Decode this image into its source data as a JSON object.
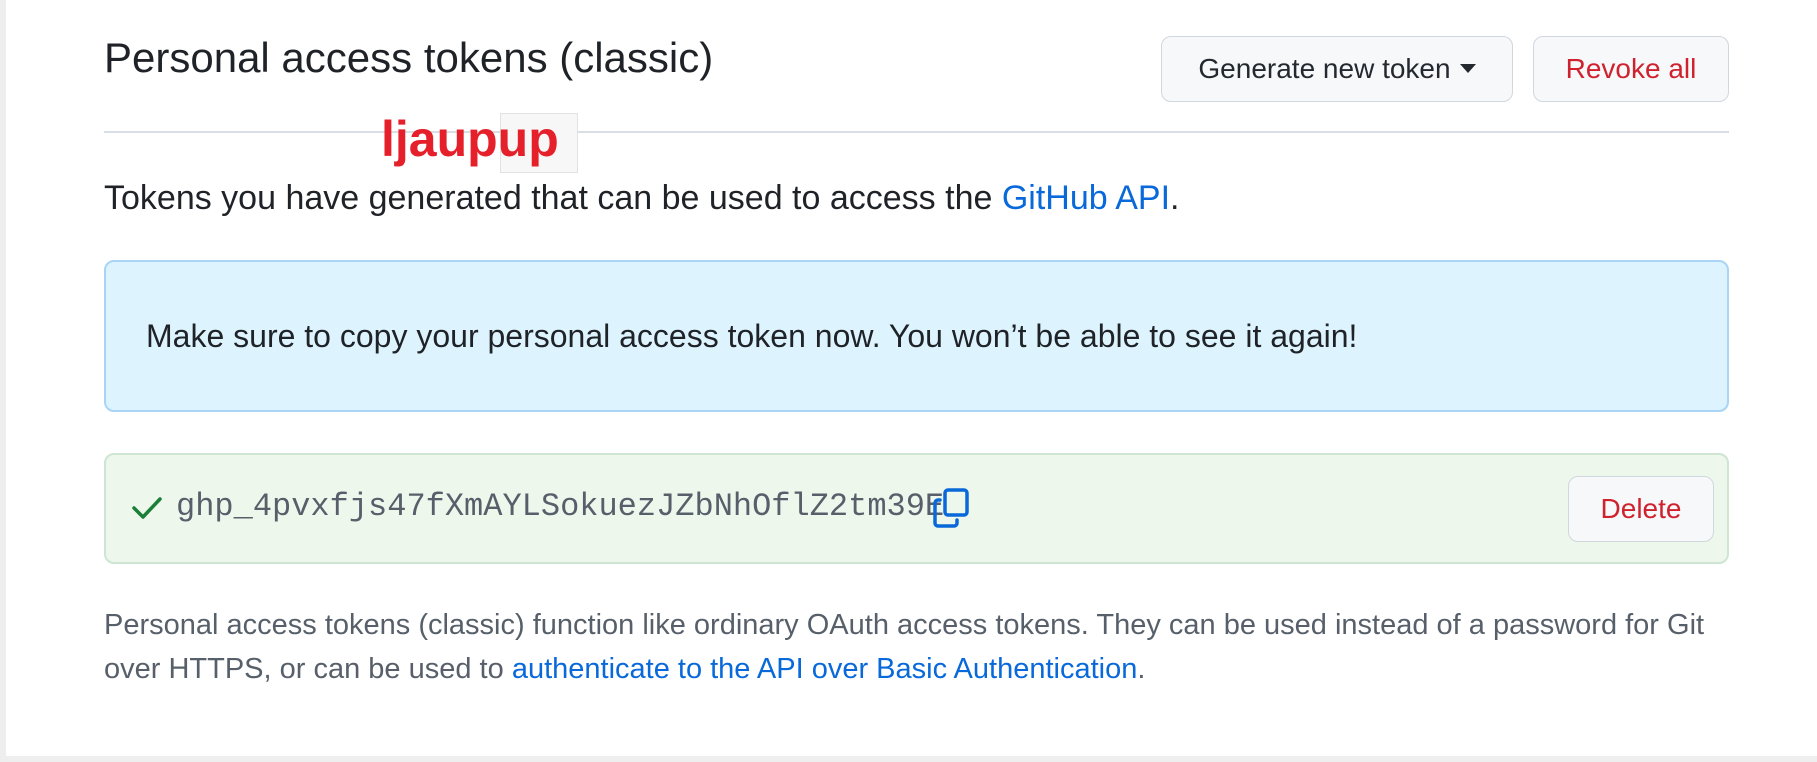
{
  "header": {
    "title": "Personal access tokens (classic)",
    "generate_button_label": "Generate new token",
    "revoke_button_label": "Revoke all"
  },
  "overlay": {
    "label": "ljaupup"
  },
  "description": {
    "text_before": "Tokens you have generated that can be used to access the ",
    "link_text": "GitHub API",
    "text_after": "."
  },
  "notice": {
    "message": "Make sure to copy your personal access token now. You won’t be able to see it again!"
  },
  "token": {
    "value": "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",
    "status_icon": "check-icon",
    "copy_icon": "copy-icon",
    "delete_button_label": "Delete"
  },
  "footer_note": {
    "text_before": "Personal access tokens (classic) function like ordinary OAuth access tokens. They can be used instead of a password for Git over HTTPS, or can be used to ",
    "link_text": "authenticate to the API over Basic Authentication",
    "text_after": "."
  },
  "colors": {
    "accent_link": "#0969da",
    "danger": "#cf222e",
    "success": "#1a7f37",
    "info_background": "#ddf4ff",
    "success_background": "#eef7ec",
    "overlay_red": "#e5202a"
  }
}
